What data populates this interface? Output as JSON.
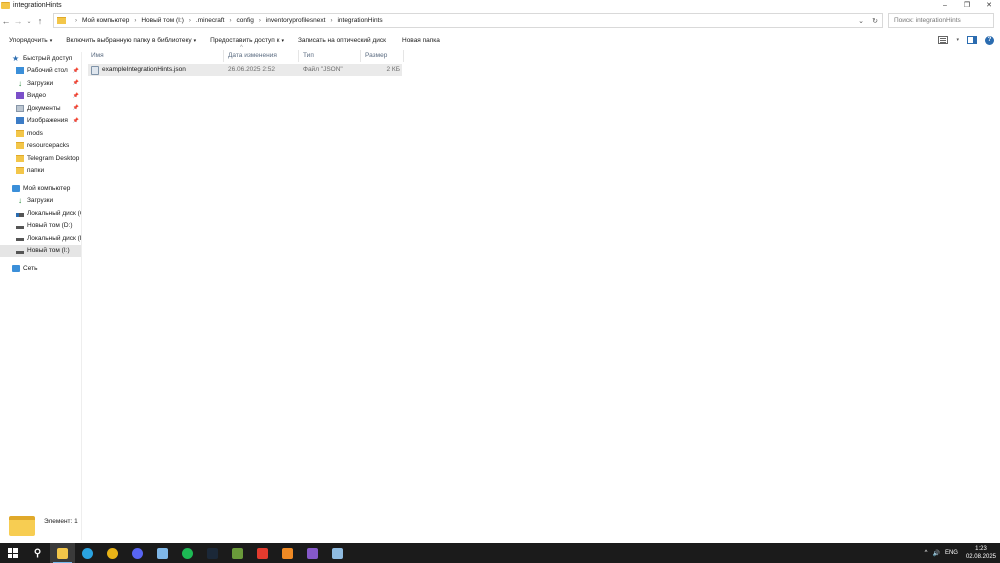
{
  "window": {
    "title": "integrationHints",
    "controls": {
      "minimize": "–",
      "maximize": "❐",
      "close": "✕"
    }
  },
  "nav": {
    "back": "←",
    "forward": "→",
    "recent": "⌄",
    "up": "↑"
  },
  "address": {
    "crumbs": [
      "Мой компьютер",
      "Новый том (I:)",
      ".minecraft",
      "config",
      "inventoryprofilesnext",
      "integrationHints"
    ],
    "dropdown": "⌄",
    "refresh": "↻"
  },
  "search": {
    "placeholder": "Поиск: integrationHints",
    "icon": "search-icon"
  },
  "toolbar": {
    "organize": "Упорядочить",
    "include_library": "Включить выбранную папку в библиотеку",
    "share": "Предоставить доступ к",
    "burn": "Записать на оптический диск",
    "new_folder": "Новая папка",
    "caret": "▾",
    "help": "?"
  },
  "sidebar": {
    "quick_access": "Быстрый доступ",
    "quick_items": [
      {
        "label": "Рабочий стол",
        "icon": "desktop-icon",
        "pinned": true
      },
      {
        "label": "Загрузки",
        "icon": "download-icon",
        "pinned": true
      },
      {
        "label": "Видео",
        "icon": "video-icon",
        "pinned": true
      },
      {
        "label": "Документы",
        "icon": "documents-icon",
        "pinned": true
      },
      {
        "label": "Изображения",
        "icon": "images-icon",
        "pinned": true
      },
      {
        "label": "mods",
        "icon": "folder-icon",
        "pinned": false
      },
      {
        "label": "resourcepacks",
        "icon": "folder-icon",
        "pinned": false
      },
      {
        "label": "Telegram Desktop",
        "icon": "folder-icon",
        "pinned": false
      },
      {
        "label": "папки",
        "icon": "folder-icon",
        "pinned": false
      }
    ],
    "pin": "📌",
    "this_pc": "Мой компьютер",
    "pc_items": [
      {
        "label": "Загрузки",
        "icon": "download-icon"
      },
      {
        "label": "Локальный диск (C",
        "icon": "drive-c-icon"
      },
      {
        "label": "Новый том (D:)",
        "icon": "drive-icon"
      },
      {
        "label": "Локальный диск (E",
        "icon": "drive-icon"
      },
      {
        "label": "Новый том (I:)",
        "icon": "drive-icon",
        "selected": true
      }
    ],
    "network": "Сеть"
  },
  "list": {
    "columns": {
      "name": "Имя",
      "date": "Дата изменения",
      "type": "Тип",
      "size": "Размер"
    },
    "sort_indicator": "^",
    "rows": [
      {
        "name": "exampleIntegrationHints.json",
        "date": "26.06.2025 2:52",
        "type": "Файл \"JSON\"",
        "size": "2 КБ"
      }
    ]
  },
  "status": {
    "count": "Элемент: 1"
  },
  "taskbar": {
    "apps": [
      {
        "name": "start-button"
      },
      {
        "name": "search-icon",
        "glyph": "⚲",
        "color": "#1b1b1b"
      },
      {
        "name": "file-explorer-icon",
        "color": "#f3c649",
        "active": true
      },
      {
        "name": "telegram-icon",
        "color": "#2aa3e0"
      },
      {
        "name": "chrome-icon",
        "color": "#e8b317"
      },
      {
        "name": "discord-icon",
        "color": "#5865f2"
      },
      {
        "name": "notepad-icon",
        "color": "#7fb7e8"
      },
      {
        "name": "spotify-icon",
        "color": "#1db954"
      },
      {
        "name": "steam-icon",
        "color": "#1b2838"
      },
      {
        "name": "minecraft-icon",
        "color": "#6a9a3a"
      },
      {
        "name": "anydesk-icon",
        "color": "#e23b2e"
      },
      {
        "name": "search-tool-icon",
        "color": "#f08a24"
      },
      {
        "name": "visual-studio-icon",
        "color": "#8659c9"
      },
      {
        "name": "notes-icon",
        "color": "#8fbbe0"
      }
    ],
    "tray": {
      "caret": "^",
      "volume": "🔊",
      "lang": "ENG"
    },
    "clock": {
      "time": "1:23",
      "date": "02.08.2025"
    }
  }
}
